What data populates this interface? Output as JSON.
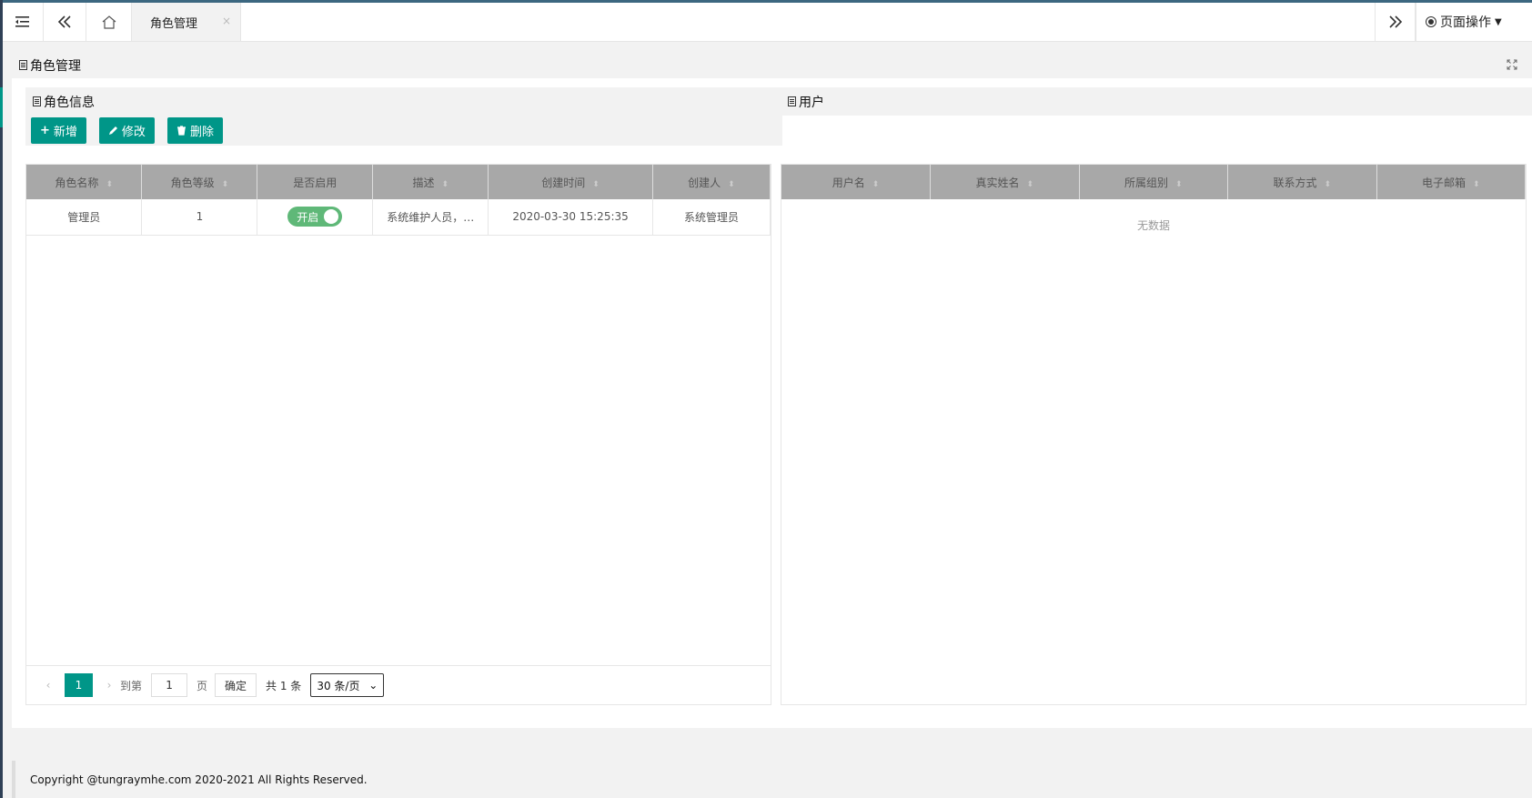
{
  "tabbar": {
    "active_tab": "角色管理",
    "close_glyph": "×",
    "page_ops_label": "页面操作"
  },
  "page": {
    "title": "角色管理"
  },
  "left_panel": {
    "title": "角色信息",
    "buttons": {
      "add": "新增",
      "edit": "修改",
      "delete": "删除"
    },
    "columns": [
      "角色名称",
      "角色等级",
      "是否启用",
      "描述",
      "创建时间",
      "创建人"
    ],
    "rows": [
      {
        "name": "管理员",
        "level": "1",
        "enabled": "开启",
        "desc": "系统维护人员，…",
        "created": "2020-03-30 15:25:35",
        "creator": "系统管理员"
      }
    ],
    "pager": {
      "current": "1",
      "goto_label": "到第",
      "goto_value": "1",
      "page_unit": "页",
      "confirm": "确定",
      "total": "共 1 条",
      "page_size": "30 条/页"
    }
  },
  "right_panel": {
    "title": "用户",
    "columns": [
      "用户名",
      "真实姓名",
      "所属组别",
      "联系方式",
      "电子邮箱"
    ],
    "empty_text": "无数据"
  },
  "footer": {
    "text": "Copyright @tungraymhe.com 2020-2021 All Rights Reserved."
  },
  "colors": {
    "primary": "#009688",
    "switch_on": "#5fb878",
    "header_gray": "#a8a8a8",
    "sidebar": "#2f4056"
  }
}
